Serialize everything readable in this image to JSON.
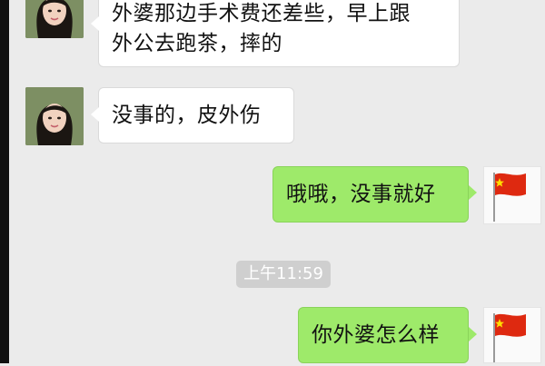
{
  "chat": {
    "messages": [
      {
        "sender": "contact",
        "lines": [
          "外婆那边手术费还差些，早上跟",
          "外公去跑茶，摔的"
        ]
      },
      {
        "sender": "contact",
        "lines": [
          "没事的，皮外伤"
        ]
      },
      {
        "sender": "me",
        "lines": [
          "哦哦，没事就好"
        ]
      },
      {
        "sender": "me",
        "lines": [
          "你外婆怎么样"
        ]
      }
    ],
    "timestamp": "上午11:59"
  },
  "colors": {
    "background": "#ebebeb",
    "incoming_bubble": "#ffffff",
    "outgoing_bubble": "#9eea6a",
    "timestamp_bg": "#cfcfcf",
    "flag_red": "#de2910",
    "flag_star": "#ffde00"
  },
  "icons": {
    "contact_avatar": "girl-portrait-icon",
    "my_avatar": "china-flag-icon"
  }
}
